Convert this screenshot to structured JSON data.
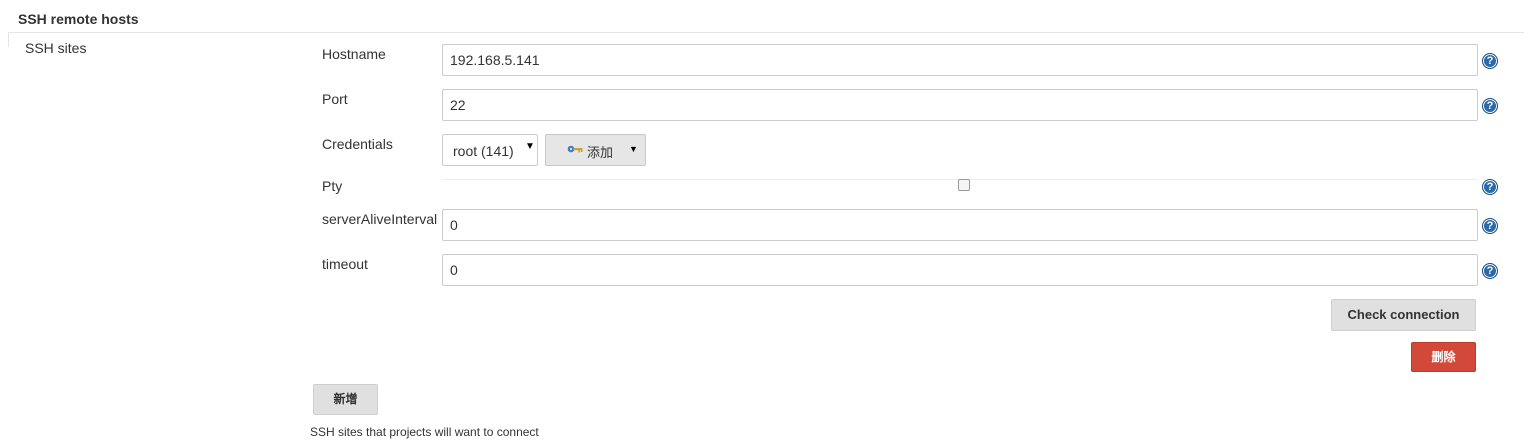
{
  "section": {
    "title": "SSH remote hosts",
    "sites_label": "SSH sites",
    "description": "SSH sites that projects will want to connect"
  },
  "fields": {
    "hostname": {
      "label": "Hostname",
      "value": "192.168.5.141"
    },
    "port": {
      "label": "Port",
      "value": "22"
    },
    "credentials": {
      "label": "Credentials",
      "selected": "root (141)",
      "add_label": "添加"
    },
    "pty": {
      "label": "Pty",
      "checked": false
    },
    "server_alive_interval": {
      "label": "serverAliveInterval",
      "value": "0"
    },
    "timeout": {
      "label": "timeout",
      "value": "0"
    }
  },
  "help_glyph": "?",
  "buttons": {
    "check_connection": "Check connection",
    "delete": "删除",
    "add_new": "新增"
  },
  "icons": {
    "help": "question-circle-icon",
    "credentials_add": "key-icon",
    "dropdown": "caret-down-icon"
  },
  "colors": {
    "help_icon": "#2a6aa8",
    "delete_button": "#d24939",
    "neutral_button": "#e0e0e0"
  }
}
